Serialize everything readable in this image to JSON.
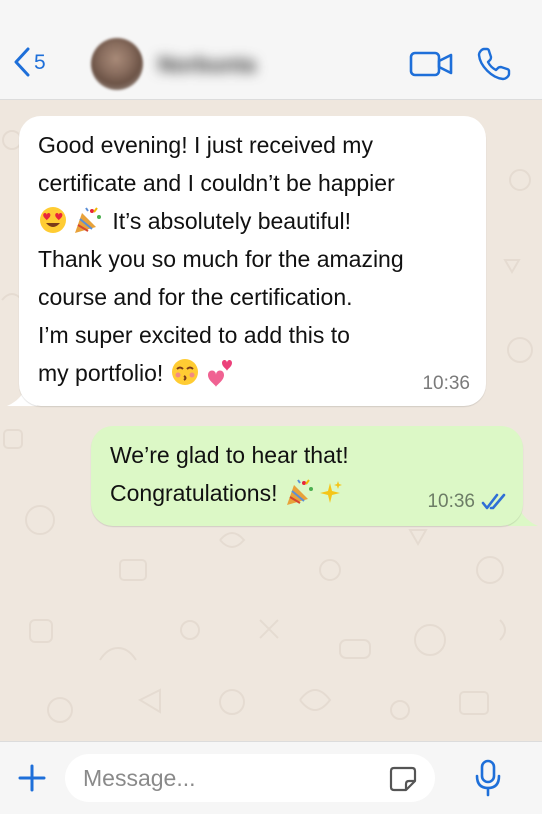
{
  "header": {
    "back_count": "5",
    "contact_name": "Norbunta"
  },
  "messages": [
    {
      "direction": "incoming",
      "lines": [
        "Good evening! I just received my",
        "certificate and I couldn’t be happier",
        " It’s absolutely beautiful!",
        "Thank you so much for the amazing",
        "course and for the certification.",
        "I’m super excited to add this to",
        "my portfolio! "
      ],
      "emojis": [
        "heart-eyes-face",
        "party-popper",
        "kissing-smiling-eyes-face",
        "two-hearts"
      ],
      "time": "10:36"
    },
    {
      "direction": "outgoing",
      "lines": [
        "We’re glad to hear that!",
        "Congratulations! "
      ],
      "emojis": [
        "party-popper",
        "sparkles"
      ],
      "time": "10:36",
      "status": "read"
    }
  ],
  "composer": {
    "placeholder": "Message..."
  },
  "colors": {
    "accent": "#1e6fd9",
    "incoming_bubble": "#ffffff",
    "outgoing_bubble": "#dcf8c6",
    "chat_background": "#efe7de",
    "read_check": "#2f6fd6"
  },
  "icons": {
    "back": "chevron-left-icon",
    "video": "video-camera-icon",
    "call": "phone-icon",
    "attach": "plus-icon",
    "sticker": "sticker-icon",
    "mic": "microphone-icon",
    "read": "double-check-icon"
  }
}
